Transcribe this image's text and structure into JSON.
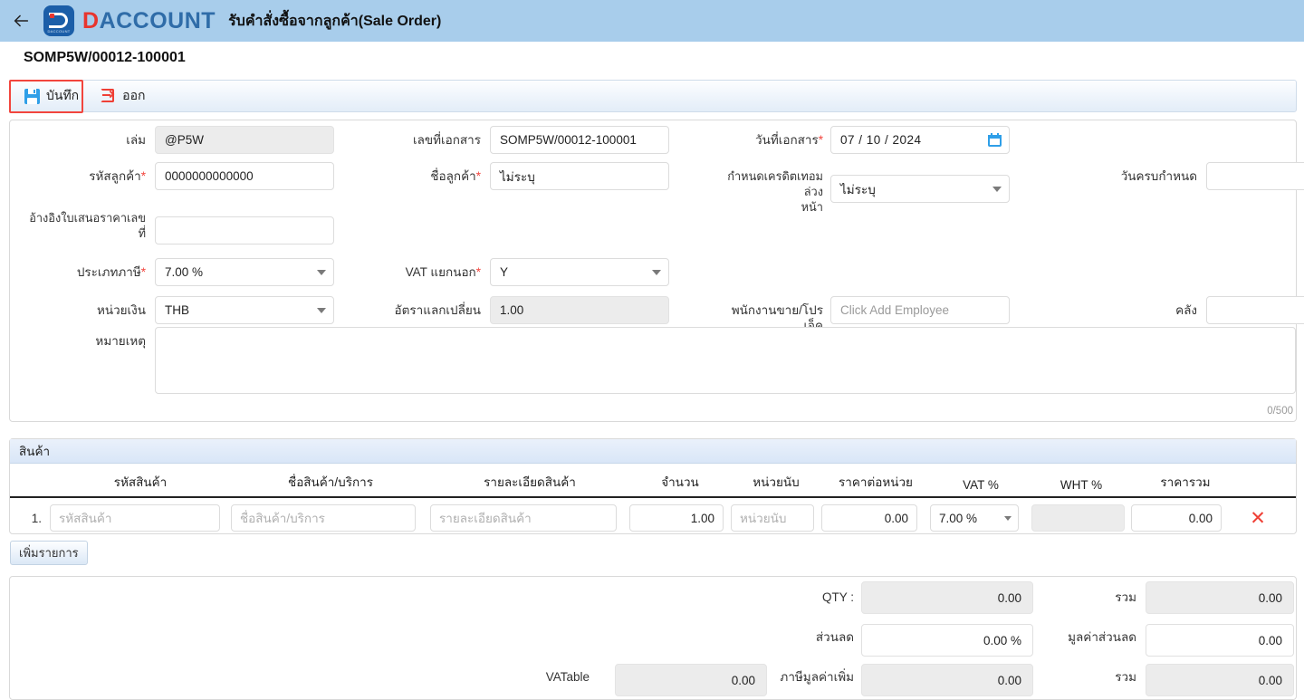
{
  "header": {
    "back_icon": "back-arrow-icon",
    "brand_mark_text": "DACCOUNT",
    "brand_d": "D",
    "brand_rest": "ACCOUNT",
    "title": "รับคำสั่งซื้อจากลูกค้า(Sale Order)",
    "bg_color": "#a8cdeb",
    "brand_blue": "#2f6ca8",
    "brand_red": "#e8352e"
  },
  "doc": {
    "number": "SOMP5W/00012-100001"
  },
  "toolbar": {
    "save_label": "บันทึก",
    "exit_label": "ออก",
    "save_icon": "floppy-disk-icon",
    "exit_icon": "exit-arrow-icon",
    "focus_color": "#f2453d"
  },
  "form": {
    "book": {
      "label": "เล่ม",
      "value": "@P5W",
      "readonly": true
    },
    "doc_no": {
      "label": "เลขที่เอกสาร",
      "value": "SOMP5W/00012-100001"
    },
    "doc_date": {
      "label": "วันที่เอกสาร",
      "required": true,
      "value": "07 / 10 / 2024",
      "icon": "calendar-icon"
    },
    "customer_code": {
      "label": "รหัสลูกค้า",
      "required": true,
      "value": "0000000000000"
    },
    "customer_name": {
      "label": "ชื่อลูกค้า",
      "required": true,
      "value": "ไม่ระบุ"
    },
    "credit_term": {
      "label": "กำหนดเครดิตเทอมล่วง\nหน้า",
      "value": "ไม่ระบุ"
    },
    "due_date": {
      "label": "วันครบกำหนด",
      "value": ""
    },
    "quotation_ref": {
      "label": "อ้างอิงใบเสนอราคาเลข\nที่",
      "value": ""
    },
    "tax_type": {
      "label": "ประเภทภาษี",
      "required": true,
      "value": "7.00 %"
    },
    "vat_separate": {
      "label": "VAT แยกนอก",
      "required": true,
      "value": "Y"
    },
    "currency": {
      "label": "หน่วยเงิน",
      "value": "THB"
    },
    "exchange_rate": {
      "label": "อัตราแลกเปลี่ยน",
      "value": "1.00",
      "readonly": true
    },
    "salesman": {
      "label": "พนักงานขาย/โปรเจ็ค",
      "placeholder": "Click Add Employee",
      "value": ""
    },
    "warehouse": {
      "label": "คลัง",
      "value": ""
    },
    "remark": {
      "label": "หมายเหตุ",
      "value": "",
      "counter": "0/500"
    }
  },
  "items": {
    "section_title": "สินค้า",
    "columns": [
      "รหัสสินค้า",
      "ชื่อสินค้า/บริการ",
      "รายละเอียดสินค้า",
      "จำนวน",
      "หน่วยนับ",
      "ราคาต่อหน่วย",
      "VAT %",
      "WHT %",
      "ราคารวม"
    ],
    "rows": [
      {
        "index": "1.",
        "code": "",
        "code_placeholder": "รหัสสินค้า",
        "name": "",
        "name_placeholder": "ชื่อสินค้า/บริการ",
        "detail": "",
        "detail_placeholder": "รายละเอียดสินค้า",
        "qty": "1.00",
        "unit": "",
        "unit_placeholder": "หน่วยนับ",
        "unit_price": "0.00",
        "vat": "7.00 %",
        "wht": "",
        "total": "0.00",
        "delete_icon": "close-x-icon"
      }
    ],
    "add_row_label": "เพิ่มรายการ"
  },
  "summary": {
    "qty": {
      "label": "QTY :",
      "value": "0.00",
      "readonly": true
    },
    "total_top": {
      "label": "รวม",
      "value": "0.00",
      "readonly": true
    },
    "discount_pct": {
      "label": "ส่วนลด",
      "value": "0.00 %",
      "readonly": false
    },
    "discount_amount": {
      "label": "มูลค่าส่วนลด",
      "value": "0.00",
      "readonly": false
    },
    "vatable": {
      "label": "VATable",
      "value": "0.00",
      "readonly": true
    },
    "vat_amount": {
      "label": "ภาษีมูลค่าเพิ่ม",
      "value": "0.00",
      "readonly": true
    },
    "grand_total": {
      "label": "รวม",
      "value": "0.00",
      "readonly": true
    }
  }
}
